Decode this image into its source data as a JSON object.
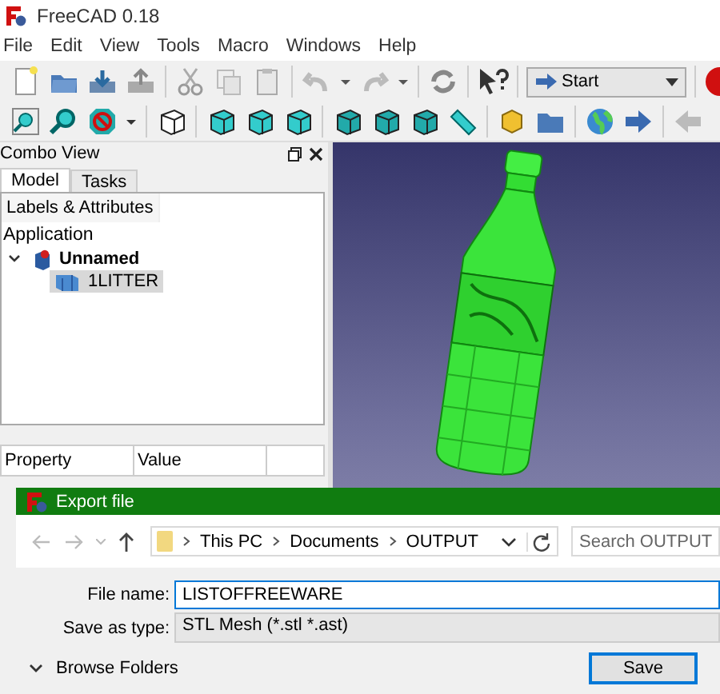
{
  "window": {
    "title": "FreeCAD 0.18"
  },
  "menu": [
    "File",
    "Edit",
    "View",
    "Tools",
    "Macro",
    "Windows",
    "Help"
  ],
  "workbench": {
    "value": "Start"
  },
  "combo_view": {
    "title": "Combo View",
    "tabs": [
      {
        "label": "Model",
        "selected": true
      },
      {
        "label": "Tasks",
        "selected": false
      }
    ],
    "section": "Labels & Attributes",
    "tree": [
      {
        "label": "Application",
        "kind": "root",
        "children": [
          {
            "label": "Unnamed",
            "kind": "document",
            "expanded": true,
            "children": [
              {
                "label": "1LITTER",
                "kind": "object",
                "selected": true
              }
            ]
          }
        ]
      }
    ]
  },
  "properties": {
    "columns": [
      "Property",
      "Value"
    ]
  },
  "dialog": {
    "title": "Export file",
    "path": [
      "This PC",
      "Documents",
      "OUTPUT"
    ],
    "search": {
      "placeholder": "Search OUTPUT"
    },
    "file_name": {
      "label": "File name:",
      "value": "LISTOFFREEWARE"
    },
    "save_as_type": {
      "label": "Save as type:",
      "value": "STL Mesh (*.stl *.ast)"
    },
    "browse": "Browse Folders",
    "buttons": [
      "Save"
    ]
  }
}
